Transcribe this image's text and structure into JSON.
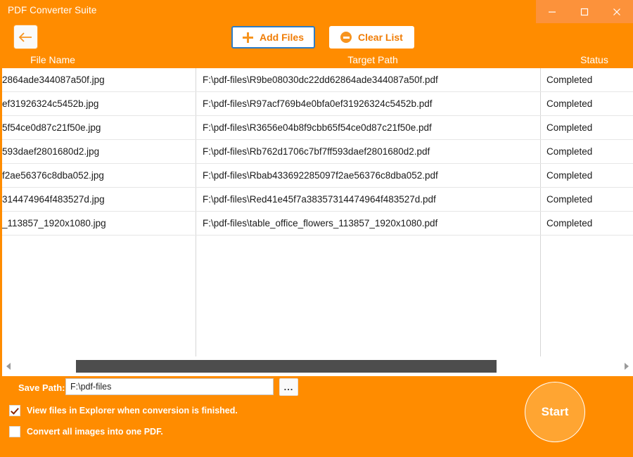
{
  "window": {
    "title": "PDF Converter Suite",
    "controls": [
      {
        "name": "minimize",
        "glyph": "minimize-icon"
      },
      {
        "name": "maximize",
        "glyph": "maximize-icon"
      },
      {
        "name": "close",
        "glyph": "close-icon"
      }
    ],
    "accent_color": "#FF8C00",
    "titlebar_controls_color": "#FC923B"
  },
  "toolbar": {
    "back_icon": "back-arrow-icon",
    "add_files_label": "Add Files",
    "add_files_icon": "plus-icon",
    "clear_list_label": "Clear List",
    "clear_list_icon": "minus-circle-icon",
    "focus_color": "#2E7CC4",
    "button_text_color": "#F07D06"
  },
  "table": {
    "columns": [
      "File Name",
      "Target Path",
      "Status"
    ],
    "rows": [
      {
        "file_name": "2864ade344087a50f.jpg",
        "target_path": "F:\\pdf-files\\R9be08030dc22dd62864ade344087a50f.pdf",
        "status": "Completed"
      },
      {
        "file_name": "ef31926324c5452b.jpg",
        "target_path": "F:\\pdf-files\\R97acf769b4e0bfa0ef31926324c5452b.pdf",
        "status": "Completed"
      },
      {
        "file_name": "5f54ce0d87c21f50e.jpg",
        "target_path": "F:\\pdf-files\\R3656e04b8f9cbb65f54ce0d87c21f50e.pdf",
        "status": "Completed"
      },
      {
        "file_name": "593daef2801680d2.jpg",
        "target_path": "F:\\pdf-files\\Rb762d1706c7bf7ff593daef2801680d2.pdf",
        "status": "Completed"
      },
      {
        "file_name": "f2ae56376c8dba052.jpg",
        "target_path": "F:\\pdf-files\\Rbab433692285097f2ae56376c8dba052.pdf",
        "status": "Completed"
      },
      {
        "file_name": "314474964f483527d.jpg",
        "target_path": "F:\\pdf-files\\Red41e45f7a38357314474964f483527d.pdf",
        "status": "Completed"
      },
      {
        "file_name": "_113857_1920x1080.jpg",
        "target_path": "F:\\pdf-files\\table_office_flowers_113857_1920x1080.pdf",
        "status": "Completed"
      }
    ]
  },
  "scrollbar": {
    "left_arrow_icon": "chevron-left-icon",
    "right_arrow_icon": "chevron-right-icon"
  },
  "footer": {
    "save_path_label": "Save Path:",
    "save_path_value": "F:\\pdf-files",
    "save_path_placeholder": "Save Path",
    "browse_label": "...",
    "option_view_files_label": "View files in Explorer when conversion is finished.",
    "option_view_files_checked": true,
    "option_one_pdf_label": "Convert all images into one PDF.",
    "option_one_pdf_checked": false,
    "start_label": "Start",
    "start_color": "#FFA532"
  }
}
